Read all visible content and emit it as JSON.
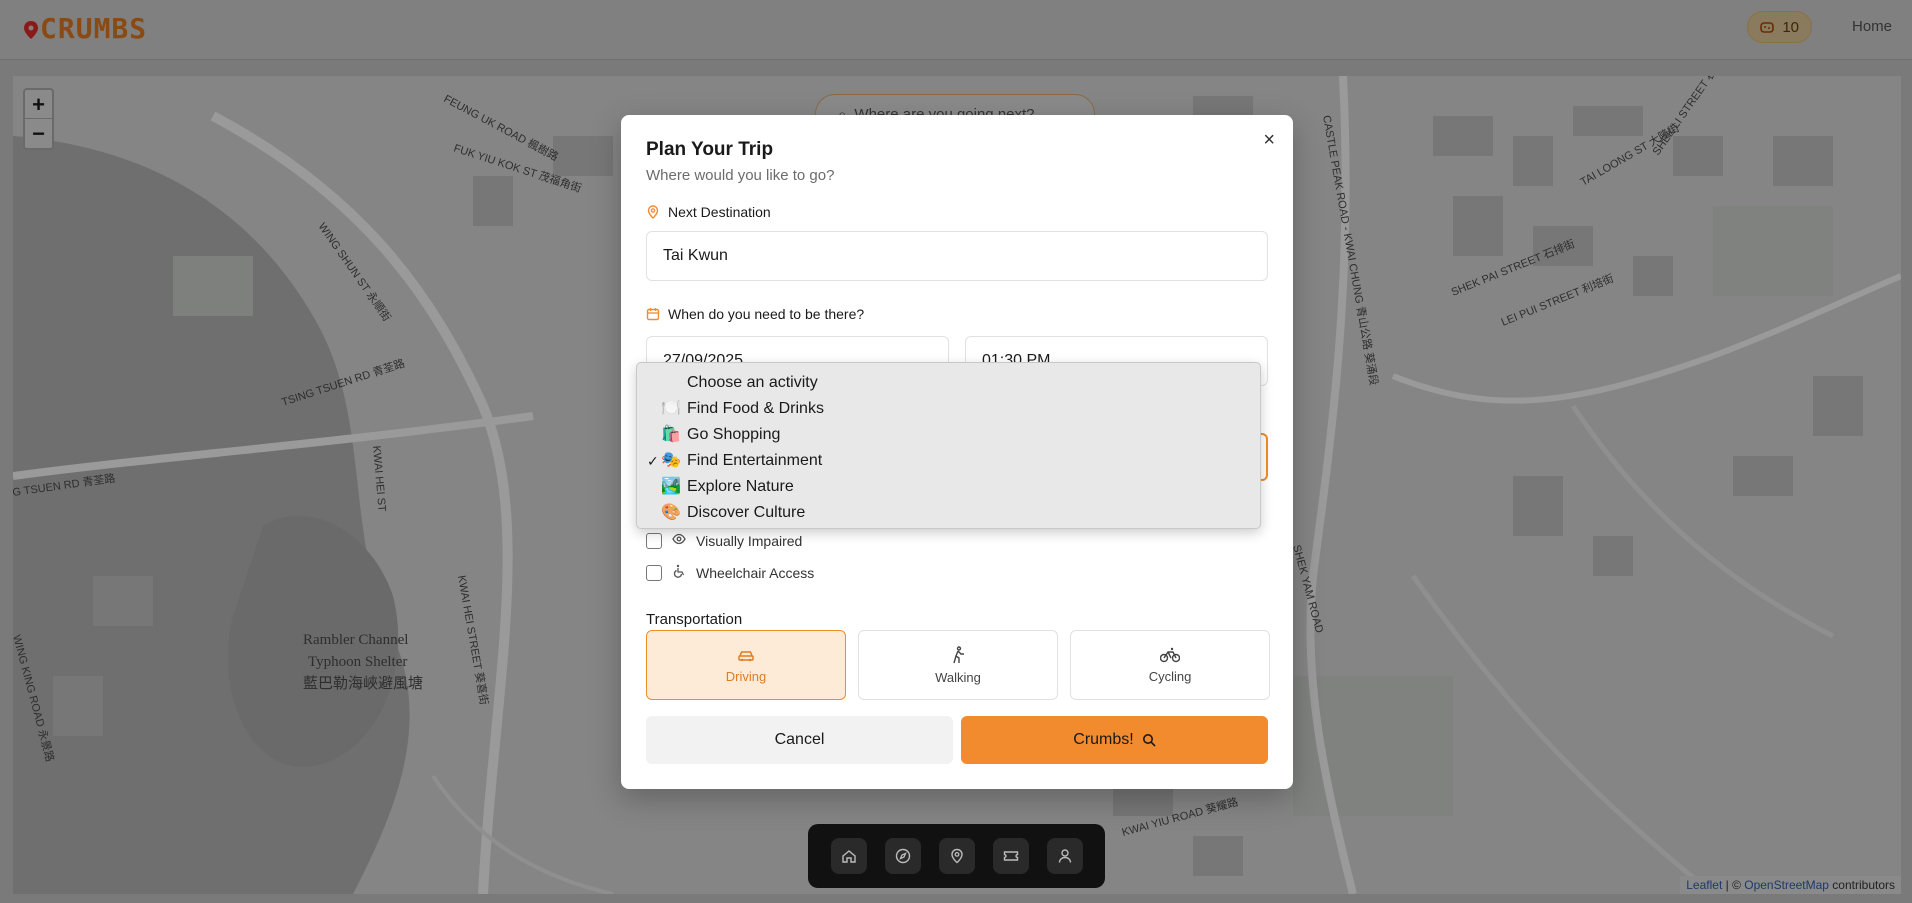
{
  "header": {
    "logo_text": "CRUMBS",
    "points": "10",
    "home_label": "Home"
  },
  "map": {
    "zoom_in": "+",
    "zoom_out": "−",
    "search_pill": "Where are you going next?",
    "attribution_leaflet": "Leaflet",
    "attribution_sep": " | © ",
    "attribution_osm": "OpenStreetMap",
    "attribution_tail": " contributors",
    "labels": {
      "l1": "FEUNG UK ROAD 楓樹路",
      "l2": "FUK YIU KOK ST 茂福角街",
      "l3": "WING SHUN ST 永順街",
      "l4": "TSING TSUEN RD 青荃路",
      "l5": "G TSUEN RD 青荃路",
      "l6": "Rambler Channel",
      "l7": "Typhoon Shelter",
      "l8": "藍巴勒海峽避風塘",
      "l9": "CASTLE PEAK ROAD - KWAI CHUNG 青山公路 葵涌段",
      "l10": "TAI LOONG ST 大隆街",
      "l11": "SHEK PAI STREET 石排街",
      "l12": "LEI PUI STREET 利培街",
      "l13": "KWAI HEI STREET 葵喜街",
      "l14": "KWAI YIU ROAD 葵耀路",
      "l15": "KWAI HEI ST",
      "l16": "WING KING ROAD 永景路",
      "l17": "SHEK YAM ROAD",
      "l18": "SHEK LI STREET 石梨街"
    }
  },
  "modal": {
    "title": "Plan Your Trip",
    "subtitle": "Where would you like to go?",
    "close_label": "×",
    "destination_label": "Next Destination",
    "destination_value": "Tai Kwun",
    "when_label": "When do you need to be there?",
    "date_value": "27/09/2025",
    "time_value": "01:30 PM",
    "options": {
      "visually_impaired": "Visually Impaired",
      "wheelchair": "Wheelchair Access"
    },
    "transport_label": "Transportation",
    "transport": [
      {
        "label": "Driving",
        "active": true
      },
      {
        "label": "Walking",
        "active": false
      },
      {
        "label": "Cycling",
        "active": false
      }
    ],
    "cancel_label": "Cancel",
    "go_label": "Crumbs!"
  },
  "dropdown": {
    "options": [
      {
        "emoji": "",
        "label": "Choose an activity",
        "selected": false
      },
      {
        "emoji": "🍽️",
        "label": "Find Food & Drinks",
        "selected": false
      },
      {
        "emoji": "🛍️",
        "label": "Go Shopping",
        "selected": false
      },
      {
        "emoji": "🎭",
        "label": "Find Entertainment",
        "selected": true
      },
      {
        "emoji": "🏞️",
        "label": "Explore Nature",
        "selected": false
      },
      {
        "emoji": "🎨",
        "label": "Discover Culture",
        "selected": false
      }
    ],
    "check_mark": "✓"
  },
  "bottom_nav": [
    "home-icon",
    "compass-icon",
    "map-pin-icon",
    "ticket-icon",
    "user-icon"
  ],
  "colors": {
    "accent": "#f28a2e",
    "accent_light": "#fdebd7"
  }
}
